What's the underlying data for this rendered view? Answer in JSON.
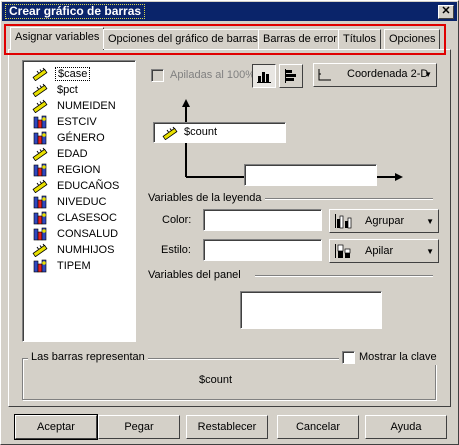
{
  "window": {
    "title": "Crear gráfico de barras",
    "close_label": "✕"
  },
  "tabs": [
    {
      "label": "Asignar variables",
      "active": true
    },
    {
      "label": "Opciones del gráfico de barras"
    },
    {
      "label": "Barras de error"
    },
    {
      "label": "Títulos"
    },
    {
      "label": "Opciones"
    }
  ],
  "variables": [
    {
      "name": "$case",
      "icon": "scale-icon"
    },
    {
      "name": "$pct",
      "icon": "scale-icon"
    },
    {
      "name": "NUMEIDEN",
      "icon": "scale-icon"
    },
    {
      "name": "ESTCIV",
      "icon": "nominal-icon"
    },
    {
      "name": "GÉNERO",
      "icon": "nominal-icon"
    },
    {
      "name": "EDAD",
      "icon": "scale-icon"
    },
    {
      "name": "REGION",
      "icon": "nominal-icon"
    },
    {
      "name": "EDUCAÑOS",
      "icon": "scale-icon"
    },
    {
      "name": "NIVEDUC",
      "icon": "nominal-icon"
    },
    {
      "name": "CLASESOC",
      "icon": "nominal-icon"
    },
    {
      "name": "CONSALUD",
      "icon": "nominal-icon"
    },
    {
      "name": "NUMHIJOS",
      "icon": "scale-icon"
    },
    {
      "name": "TIPEM",
      "icon": "nominal-icon"
    }
  ],
  "options": {
    "stacked_label": "Apiladas al 100%",
    "stacked_checked": false,
    "coordinate_select": "Coordenada 2-D"
  },
  "axes": {
    "y_variable": "$count",
    "x_variable": ""
  },
  "legend_vars": {
    "heading": "Variables de la leyenda",
    "color_label": "Color:",
    "color_value": "",
    "color_action": "Agrupar",
    "style_label": "Estilo:",
    "style_value": "",
    "style_action": "Apilar"
  },
  "panel_vars": {
    "heading": "Variables del panel",
    "value": ""
  },
  "bars_represent": {
    "heading": "Las barras representan",
    "show_key_label": "Mostrar la clave",
    "show_key_checked": false,
    "value": "$count"
  },
  "buttons": {
    "accept": "Aceptar",
    "paste": "Pegar",
    "reset": "Restablecer",
    "cancel": "Cancelar",
    "help": "Ayuda"
  }
}
